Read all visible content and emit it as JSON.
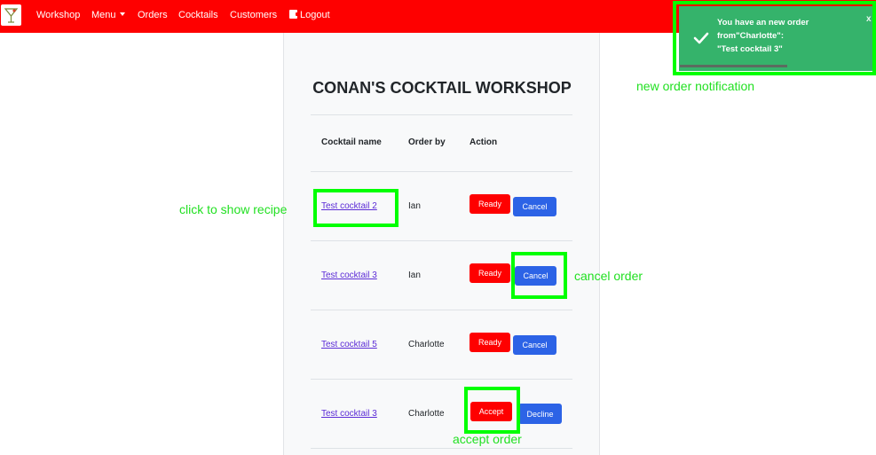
{
  "navbar": {
    "brand_icon": "cocktail-glass-icon",
    "items": {
      "workshop": "Workshop",
      "menu": "Menu",
      "orders": "Orders",
      "cocktails": "Cocktails",
      "customers": "Customers",
      "logout": "Logout"
    },
    "color": "#fe0000"
  },
  "card": {
    "title": "CONAN'S COCKTAIL WORKSHOP",
    "headers": {
      "name": "Cocktail name",
      "order_by": "Order by",
      "action": "Action"
    },
    "rows": [
      {
        "name": "Test cocktail 2",
        "order_by": "Ian",
        "primary": "Ready",
        "secondary": "Cancel"
      },
      {
        "name": "Test cocktail 3",
        "order_by": "Ian",
        "primary": "Ready",
        "secondary": "Cancel"
      },
      {
        "name": "Test cocktail 5",
        "order_by": "Charlotte",
        "primary": "Ready",
        "secondary": "Cancel"
      },
      {
        "name": "Test cocktail 3",
        "order_by": "Charlotte",
        "primary": "Accept",
        "secondary": "Decline"
      }
    ]
  },
  "toast": {
    "line1": "You have an new order",
    "line2": "from\"Charlotte\":",
    "line3": "\"Test cocktail 3\"",
    "close": "x",
    "icon": "checkmark-icon",
    "color": "#35b36b"
  },
  "annotations": {
    "notification": "new order notification",
    "recipe": "click to show recipe",
    "cancel": "cancel order",
    "accept": "accept order",
    "color": "#00ff00"
  }
}
